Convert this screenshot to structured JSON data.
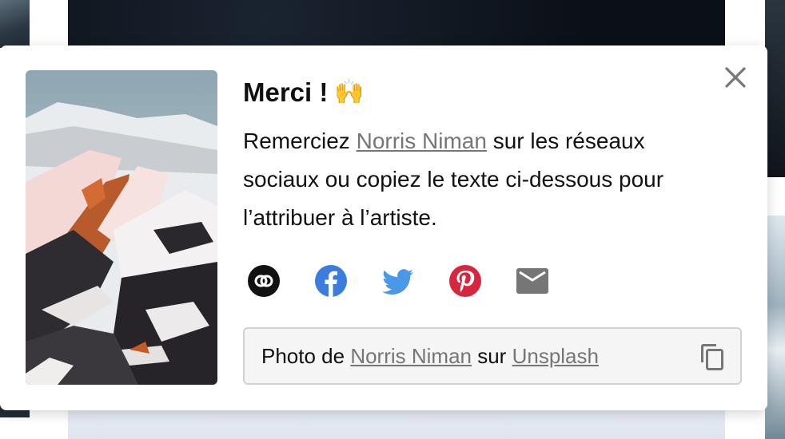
{
  "modal": {
    "title": "Merci !",
    "title_emoji": "🙌",
    "message": {
      "before": "Remerciez ",
      "artist_link": "Norris Niman",
      "after": " sur les réseaux sociaux ou copiez le texte ci-dessous pour l’attribuer à l’artiste."
    },
    "share_icons": [
      "link-icon",
      "facebook-icon",
      "twitter-icon",
      "pinterest-icon",
      "email-icon"
    ],
    "credit": {
      "prefix": "Photo de ",
      "artist": "Norris Niman",
      "middle": " sur ",
      "site": "Unsplash"
    },
    "close_icon": "close-icon",
    "copy_icon": "copy-icon"
  },
  "colors": {
    "facebook": "#3b7ddd",
    "twitter": "#4a99e9",
    "pinterest": "#d7263d",
    "email": "#767676",
    "link_bg": "#111111",
    "credit_bg": "#f5f5f5",
    "link_text": "#767676"
  }
}
